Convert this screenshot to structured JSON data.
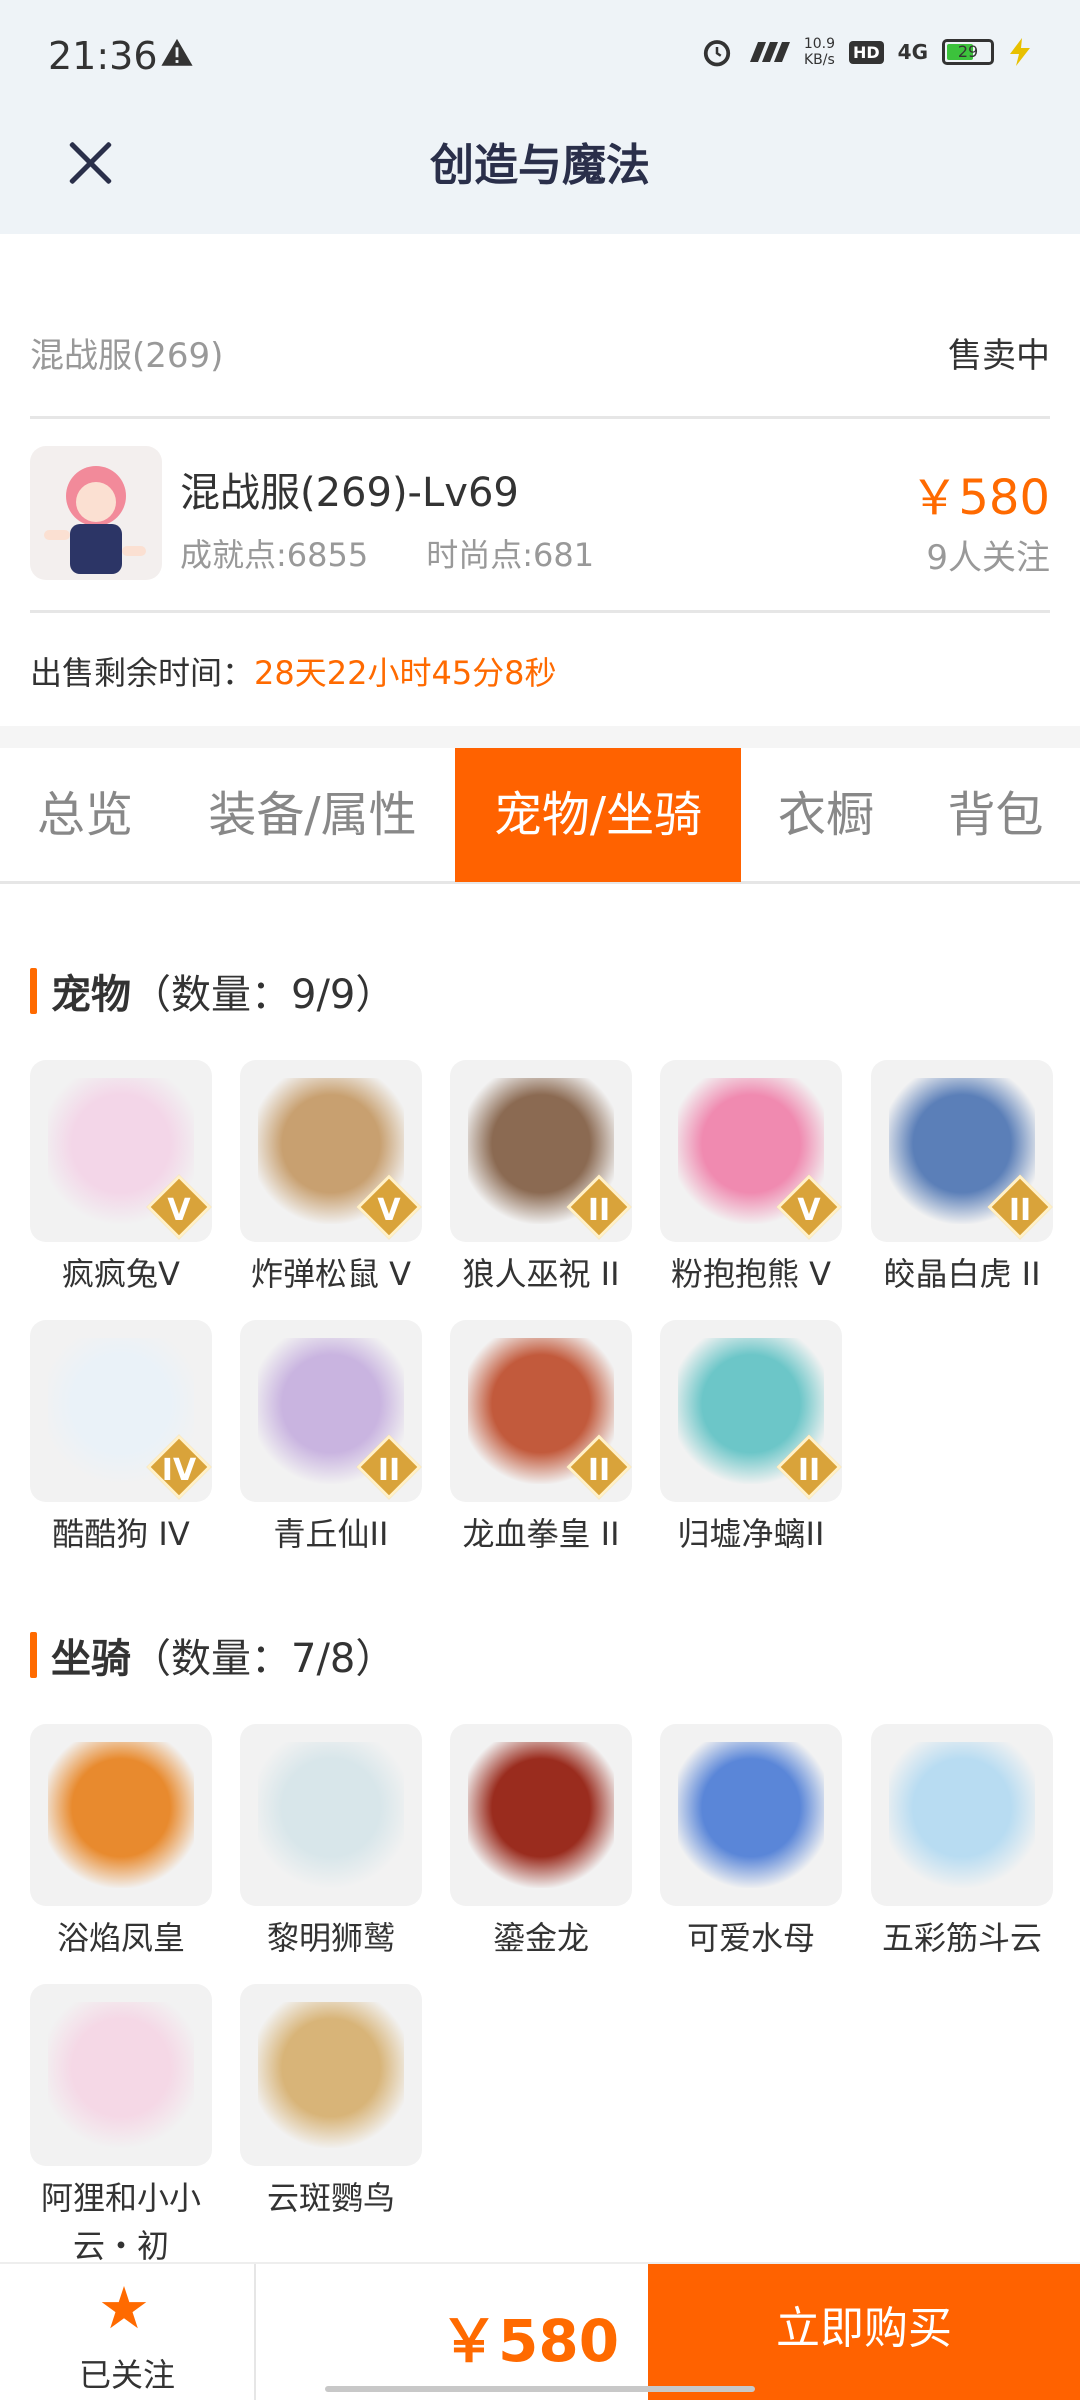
{
  "status_bar": {
    "time": "21:36",
    "net_speed_value": "10.9",
    "net_speed_unit": "KB/s",
    "hd": "HD",
    "network": "4G",
    "battery": "29"
  },
  "header": {
    "title": "创造与魔法"
  },
  "listing": {
    "server": "混战服(269)",
    "status": "售卖中",
    "character_name": "混战服(269)-Lv69",
    "achievement": "成就点:6855",
    "fashion": "时尚点:681",
    "price": "￥580",
    "followers": "9人关注",
    "time_label": "出售剩余时间：",
    "time_value": "28天22小时45分8秒"
  },
  "tabs": [
    {
      "label": "总览"
    },
    {
      "label": "装备/属性"
    },
    {
      "label": "宠物/坐骑"
    },
    {
      "label": "衣橱"
    },
    {
      "label": "背包"
    }
  ],
  "pets": {
    "title": "宠物",
    "count": "（数量：9/9）",
    "items": [
      {
        "name": "疯疯兔V",
        "badge": "V",
        "color": "#f3d6e8"
      },
      {
        "name": "炸弹松鼠 V",
        "badge": "V",
        "color": "#c8a070"
      },
      {
        "name": "狼人巫祝 II",
        "badge": "II",
        "color": "#8b6a52"
      },
      {
        "name": "粉抱抱熊 V",
        "badge": "V",
        "color": "#f08ab0"
      },
      {
        "name": "皎晶白虎 II",
        "badge": "II",
        "color": "#5b7fb8"
      },
      {
        "name": "酷酷狗 IV",
        "badge": "IV",
        "color": "#eaf2f8"
      },
      {
        "name": "青丘仙II",
        "badge": "II",
        "color": "#c9b4e0"
      },
      {
        "name": "龙血拳皇 II",
        "badge": "II",
        "color": "#c25a3c"
      },
      {
        "name": "归墟净螭II",
        "badge": "II",
        "color": "#6cc6c8"
      }
    ]
  },
  "mounts": {
    "title": "坐骑",
    "count": "（数量：7/8）",
    "items": [
      {
        "name": "浴焰凤皇",
        "color": "#e88a2e"
      },
      {
        "name": "黎明狮鹫",
        "color": "#d8e6ea"
      },
      {
        "name": "鎏金龙",
        "color": "#9a2c1e"
      },
      {
        "name": "可爱水母",
        "color": "#5a86d8"
      },
      {
        "name": "五彩筋斗云",
        "color": "#b8dcf2"
      },
      {
        "name": "阿狸和小小云・初",
        "color": "#f5d8e6"
      },
      {
        "name": "云斑鹦鸟",
        "color": "#d8b478"
      }
    ]
  },
  "bottom": {
    "follow_label": "已关注",
    "price": "￥580",
    "buy_label": "立即购买"
  }
}
